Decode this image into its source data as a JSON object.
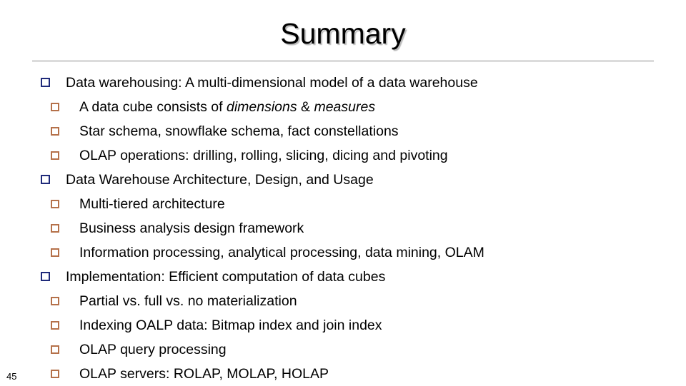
{
  "slide": {
    "title": "Summary",
    "page_number": "45",
    "colors": {
      "level1_bullet": "#1F2A7A",
      "level2_bullet": "#B5714A",
      "rule": "#888888",
      "text": "#000000",
      "background": "#FFFFFF"
    },
    "lines": [
      {
        "level": 1,
        "text": "Data warehousing: A multi-dimensional model of a data warehouse"
      },
      {
        "level": 2,
        "text": "A data cube consists of dimensions & measures",
        "runs": [
          {
            "text": "A data cube consists of ",
            "italic": false
          },
          {
            "text": "dimensions",
            "italic": true
          },
          {
            "text": " & ",
            "italic": false
          },
          {
            "text": "measures",
            "italic": true
          }
        ]
      },
      {
        "level": 2,
        "text": "Star schema, snowflake schema, fact constellations"
      },
      {
        "level": 2,
        "text": "OLAP operations: drilling, rolling, slicing, dicing and pivoting"
      },
      {
        "level": 1,
        "text": "Data Warehouse Architecture, Design, and Usage"
      },
      {
        "level": 2,
        "text": "Multi-tiered architecture"
      },
      {
        "level": 2,
        "text": "Business analysis design framework"
      },
      {
        "level": 2,
        "text": "Information processing, analytical processing, data mining, OLAM"
      },
      {
        "level": 1,
        "text": "Implementation: Efficient computation of data cubes"
      },
      {
        "level": 2,
        "text": "Partial vs. full vs. no materialization"
      },
      {
        "level": 2,
        "text": "Indexing OALP data: Bitmap index and join index"
      },
      {
        "level": 2,
        "text": "OLAP query processing"
      },
      {
        "level": 2,
        "text": "OLAP servers: ROLAP, MOLAP, HOLAP"
      }
    ]
  }
}
